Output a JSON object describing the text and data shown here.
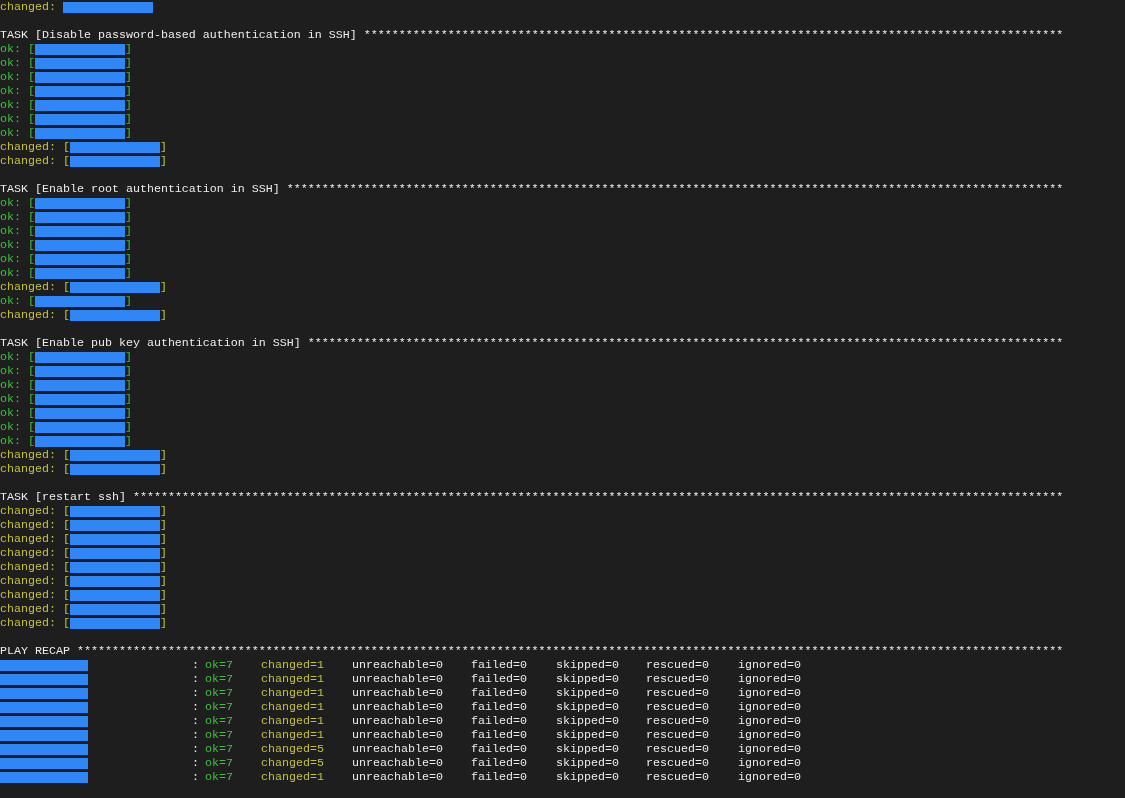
{
  "lines": [
    {
      "kind": "changed",
      "label": "changed:"
    },
    {
      "kind": "blank"
    },
    {
      "kind": "header",
      "text": "TASK [Disable password-based authentication in SSH]",
      "stars": "****************************************************************************************************"
    },
    {
      "kind": "ok",
      "label": "ok:",
      "open": "[",
      "close": "]"
    },
    {
      "kind": "ok",
      "label": "ok:",
      "open": "[",
      "close": "]"
    },
    {
      "kind": "ok",
      "label": "ok:",
      "open": "[",
      "close": "]"
    },
    {
      "kind": "ok",
      "label": "ok:",
      "open": "[",
      "close": "]"
    },
    {
      "kind": "ok",
      "label": "ok:",
      "open": "[",
      "close": "]"
    },
    {
      "kind": "ok",
      "label": "ok:",
      "open": "[",
      "close": "]"
    },
    {
      "kind": "ok",
      "label": "ok:",
      "open": "[",
      "close": "]"
    },
    {
      "kind": "changed",
      "label": "changed:",
      "open": "[",
      "close": "]"
    },
    {
      "kind": "changed",
      "label": "changed:",
      "open": "[",
      "close": "]"
    },
    {
      "kind": "blank"
    },
    {
      "kind": "header",
      "text": "TASK [Enable root authentication in SSH]",
      "stars": "***************************************************************************************************************"
    },
    {
      "kind": "ok",
      "label": "ok:",
      "open": "[",
      "close": "]"
    },
    {
      "kind": "ok",
      "label": "ok:",
      "open": "[",
      "close": "]"
    },
    {
      "kind": "ok",
      "label": "ok:",
      "open": "[",
      "close": "]"
    },
    {
      "kind": "ok",
      "label": "ok:",
      "open": "[",
      "close": "]"
    },
    {
      "kind": "ok",
      "label": "ok:",
      "open": "[",
      "close": "]"
    },
    {
      "kind": "ok",
      "label": "ok:",
      "open": "[",
      "close": "]"
    },
    {
      "kind": "changed",
      "label": "changed:",
      "open": "[",
      "close": "]"
    },
    {
      "kind": "ok",
      "label": "ok:",
      "open": "[",
      "close": "]"
    },
    {
      "kind": "changed",
      "label": "changed:",
      "open": "[",
      "close": "]"
    },
    {
      "kind": "blank"
    },
    {
      "kind": "header",
      "text": "TASK [Enable pub key authentication in SSH]",
      "stars": "************************************************************************************************************"
    },
    {
      "kind": "ok",
      "label": "ok:",
      "open": "[",
      "close": "]"
    },
    {
      "kind": "ok",
      "label": "ok:",
      "open": "[",
      "close": "]"
    },
    {
      "kind": "ok",
      "label": "ok:",
      "open": "[",
      "close": "]"
    },
    {
      "kind": "ok",
      "label": "ok:",
      "open": "[",
      "close": "]"
    },
    {
      "kind": "ok",
      "label": "ok:",
      "open": "[",
      "close": "]"
    },
    {
      "kind": "ok",
      "label": "ok:",
      "open": "[",
      "close": "]"
    },
    {
      "kind": "ok",
      "label": "ok:",
      "open": "[",
      "close": "]"
    },
    {
      "kind": "changed",
      "label": "changed:",
      "open": "[",
      "close": "]"
    },
    {
      "kind": "changed",
      "label": "changed:",
      "open": "[",
      "close": "]"
    },
    {
      "kind": "blank"
    },
    {
      "kind": "header",
      "text": "TASK [restart ssh]",
      "stars": "*************************************************************************************************************************************"
    },
    {
      "kind": "changed",
      "label": "changed:",
      "open": "[",
      "close": "]"
    },
    {
      "kind": "changed",
      "label": "changed:",
      "open": "[",
      "close": "]"
    },
    {
      "kind": "changed",
      "label": "changed:",
      "open": "[",
      "close": "]"
    },
    {
      "kind": "changed",
      "label": "changed:",
      "open": "[",
      "close": "]"
    },
    {
      "kind": "changed",
      "label": "changed:",
      "open": "[",
      "close": "]"
    },
    {
      "kind": "changed",
      "label": "changed:",
      "open": "[",
      "close": "]"
    },
    {
      "kind": "changed",
      "label": "changed:",
      "open": "[",
      "close": "]"
    },
    {
      "kind": "changed",
      "label": "changed:",
      "open": "[",
      "close": "]"
    },
    {
      "kind": "changed",
      "label": "changed:",
      "open": "[",
      "close": "]"
    },
    {
      "kind": "blank"
    }
  ],
  "recap": {
    "title": "PLAY RECAP",
    "stars": "*********************************************************************************************************************************************",
    "rows": [
      {
        "sep": ":",
        "ok": "ok=7",
        "changed": "changed=1",
        "unreachable": "unreachable=0",
        "failed": "failed=0",
        "skipped": "skipped=0",
        "rescued": "rescued=0",
        "ignored": "ignored=0"
      },
      {
        "sep": ":",
        "ok": "ok=7",
        "changed": "changed=1",
        "unreachable": "unreachable=0",
        "failed": "failed=0",
        "skipped": "skipped=0",
        "rescued": "rescued=0",
        "ignored": "ignored=0"
      },
      {
        "sep": ":",
        "ok": "ok=7",
        "changed": "changed=1",
        "unreachable": "unreachable=0",
        "failed": "failed=0",
        "skipped": "skipped=0",
        "rescued": "rescued=0",
        "ignored": "ignored=0"
      },
      {
        "sep": ":",
        "ok": "ok=7",
        "changed": "changed=1",
        "unreachable": "unreachable=0",
        "failed": "failed=0",
        "skipped": "skipped=0",
        "rescued": "rescued=0",
        "ignored": "ignored=0"
      },
      {
        "sep": ":",
        "ok": "ok=7",
        "changed": "changed=1",
        "unreachable": "unreachable=0",
        "failed": "failed=0",
        "skipped": "skipped=0",
        "rescued": "rescued=0",
        "ignored": "ignored=0"
      },
      {
        "sep": ":",
        "ok": "ok=7",
        "changed": "changed=1",
        "unreachable": "unreachable=0",
        "failed": "failed=0",
        "skipped": "skipped=0",
        "rescued": "rescued=0",
        "ignored": "ignored=0"
      },
      {
        "sep": ":",
        "ok": "ok=7",
        "changed": "changed=5",
        "unreachable": "unreachable=0",
        "failed": "failed=0",
        "skipped": "skipped=0",
        "rescued": "rescued=0",
        "ignored": "ignored=0"
      },
      {
        "sep": ":",
        "ok": "ok=7",
        "changed": "changed=5",
        "unreachable": "unreachable=0",
        "failed": "failed=0",
        "skipped": "skipped=0",
        "rescued": "rescued=0",
        "ignored": "ignored=0"
      },
      {
        "sep": ":",
        "ok": "ok=7",
        "changed": "changed=1",
        "unreachable": "unreachable=0",
        "failed": "failed=0",
        "skipped": "skipped=0",
        "rescued": "rescued=0",
        "ignored": "ignored=0"
      }
    ]
  }
}
